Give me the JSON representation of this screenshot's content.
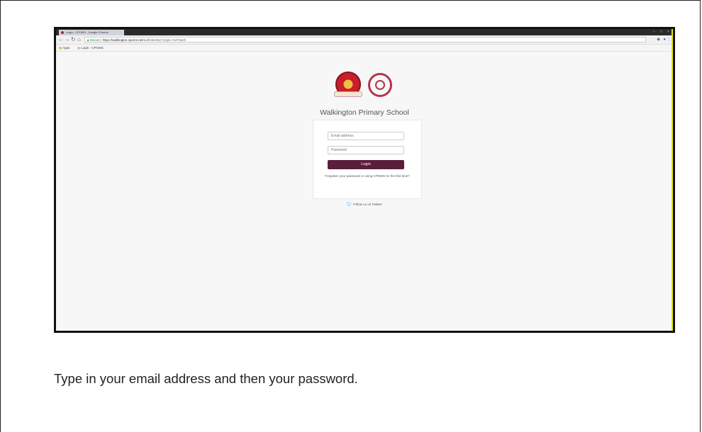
{
  "browser": {
    "tab_title": "Login - CPOMS - Google Chrome",
    "secure_label": "Secure",
    "url_host": "https://walkington.cpoms.net",
    "url_path": "/auth/identity?origin=%2Fdash",
    "bookmark_apps": "Apps",
    "bookmark_login": "Login - CPOMS"
  },
  "page": {
    "school_name": "Walkington Primary School",
    "email_placeholder": "Email address",
    "password_placeholder": "Password",
    "login_label": "Login",
    "forgot_text": "Forgotten your password or using CPOMS for the first time?",
    "twitter_text": "Follow us on Twitter!"
  },
  "caption": "Type in your email address and then your password.",
  "colors": {
    "login_button": "#5a1e3a",
    "cpoms_logo": "#b0364a",
    "twitter": "#1da1f2"
  },
  "icons": [
    "back-icon",
    "forward-icon",
    "reload-icon",
    "home-icon",
    "lock-icon",
    "extensions-icon",
    "menu-icon",
    "twitter-icon"
  ]
}
